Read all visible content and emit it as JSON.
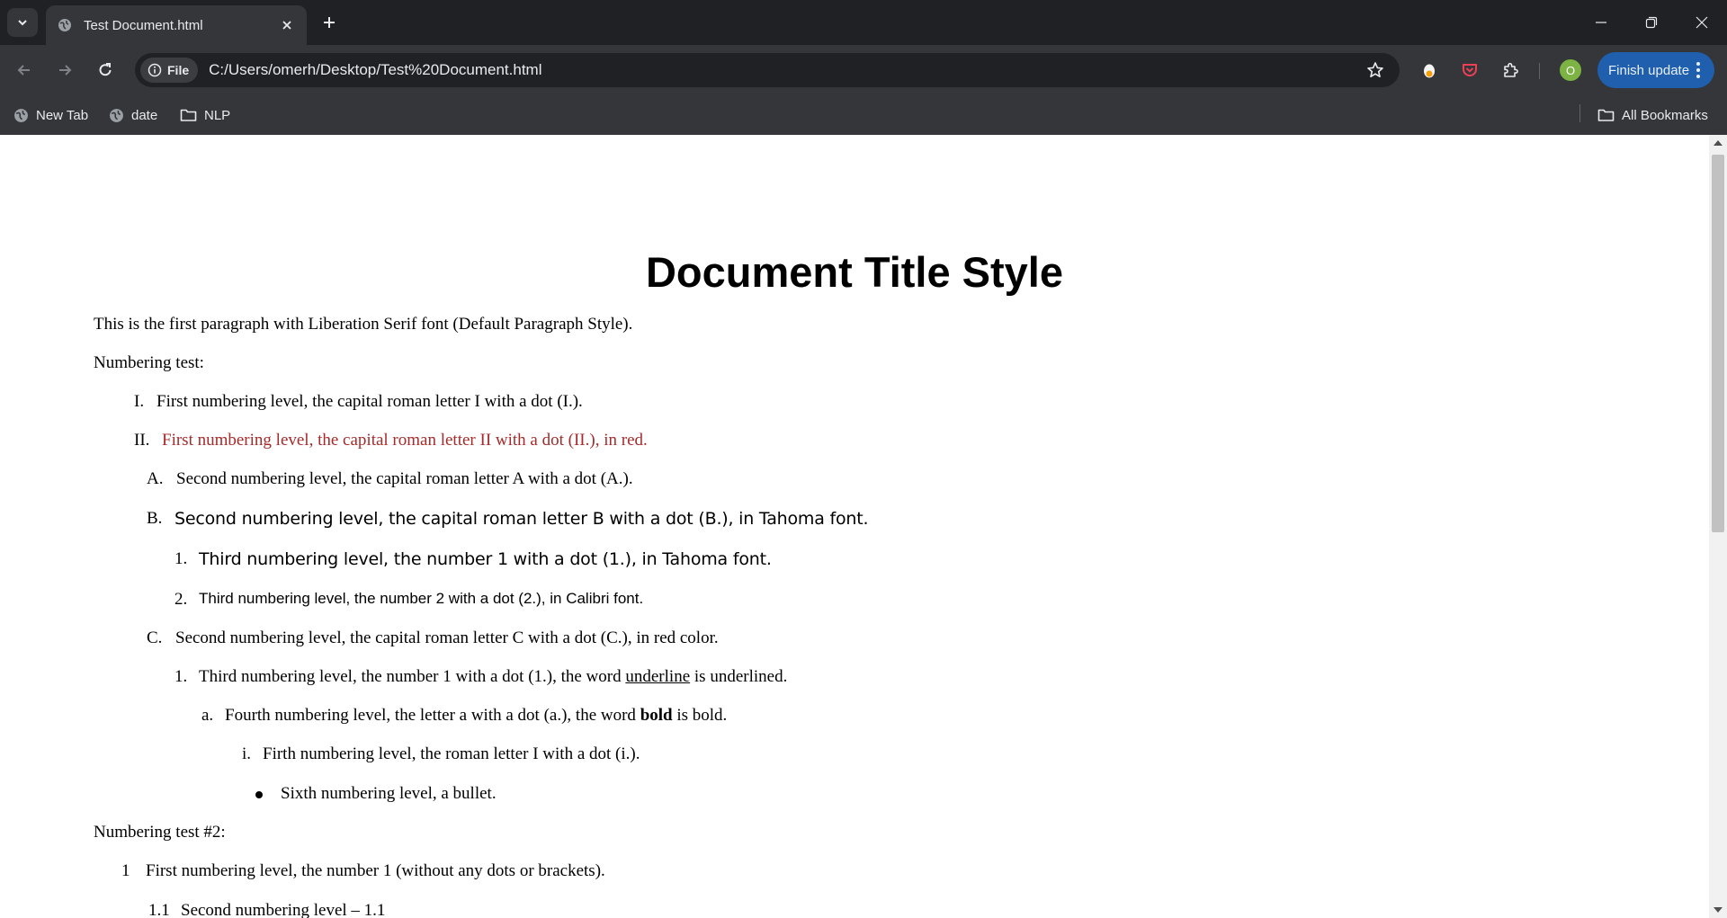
{
  "browser": {
    "tab_title": "Test Document.html",
    "site_chip_label": "File",
    "url": "C:/Users/omerh/Desktop/Test%20Document.html",
    "avatar_initial": "O",
    "finish_update_label": "Finish update",
    "colors": {
      "frame": "#202124",
      "toolbar": "#35363a",
      "accent": "#1f5fae"
    }
  },
  "bookmarks": {
    "items": [
      {
        "label": "New Tab",
        "icon": "globe-icon"
      },
      {
        "label": "date",
        "icon": "globe-icon"
      },
      {
        "label": "NLP",
        "icon": "folder-icon"
      }
    ],
    "all_bookmarks_label": "All Bookmarks"
  },
  "document": {
    "title": "Document Title Style",
    "intro": "This is the first paragraph with Liberation Serif font (Default Paragraph Style).",
    "numbering_test_label": "Numbering test:",
    "items": [
      {
        "marker": "I.",
        "text": "First numbering level, the capital roman letter I with a dot (I.)."
      },
      {
        "marker": "II.",
        "text": "First numbering level, the capital roman letter II with a dot (II.), in red."
      },
      {
        "marker": "A.",
        "text": "Second numbering level, the capital roman letter A with a dot (A.)."
      },
      {
        "marker": "B.",
        "text": "Second numbering level, the capital roman letter B with a dot (B.), in Tahoma font."
      },
      {
        "marker": "1.",
        "text": "Third numbering level, the number 1 with a dot (1.), in Tahoma font."
      },
      {
        "marker": "2.",
        "text": "Third numbering level, the number 2 with a dot (2.), in Calibri font."
      },
      {
        "marker": "C.",
        "text": "Second numbering level, the capital roman letter C with a dot (C.), in red color."
      },
      {
        "marker": "1.",
        "text_before": "Third numbering level, the number 1 with a dot (1.), the word ",
        "emph": "underline",
        "text_after": " is underlined."
      },
      {
        "marker": "a.",
        "text_before": "Fourth numbering level, the letter a with a dot (a.), the word ",
        "emph": "bold",
        "text_after": " is bold."
      },
      {
        "marker": "i.",
        "text": "Firth numbering level, the roman letter I with a dot (i.)."
      },
      {
        "marker": "",
        "text": "Sixth numbering level, a bullet."
      }
    ],
    "numbering_test2_label": "Numbering test #2:",
    "items2": [
      {
        "marker": "1",
        "text": "First numbering level, the number 1 (without any dots or brackets)."
      },
      {
        "marker": "1.1",
        "text": "Second numbering level – 1.1"
      }
    ]
  }
}
